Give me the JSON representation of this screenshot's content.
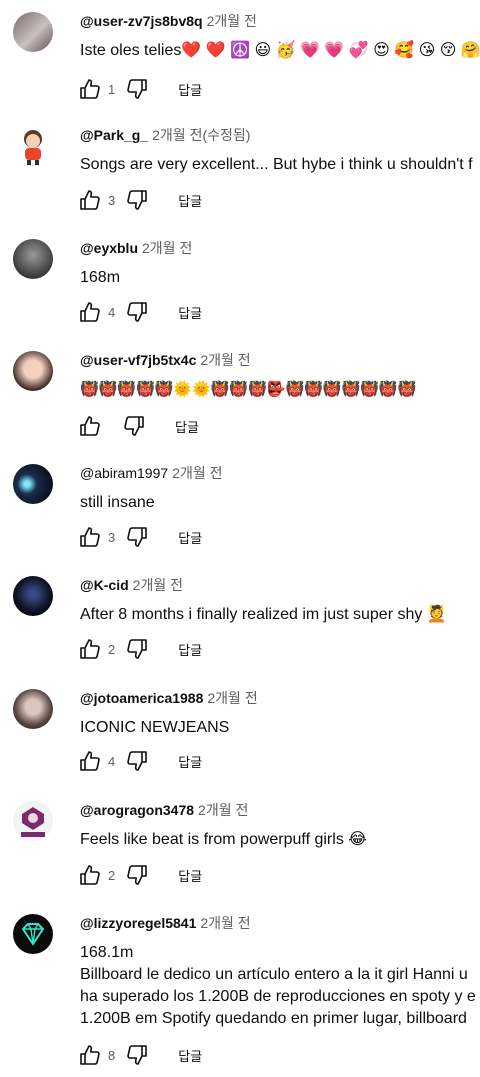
{
  "reply_label": "답글",
  "comments": [
    {
      "handle": "@user-zv7js8bv8q",
      "time": "2개월 전",
      "text": "Iste oles telies❤️ ❤️ ☮️ 😃 🥳 💗 💗 💞 😍 🥰 😘 😚 🤗",
      "likes": "1"
    },
    {
      "handle": "@Park_g_",
      "time": "2개월 전(수정됨)",
      "text": "Songs are very excellent... But hybe i think u shouldn't f",
      "likes": "3"
    },
    {
      "handle": "@eyxblu",
      "time": "2개월 전",
      "text": "168m",
      "likes": "4"
    },
    {
      "handle": "@user-vf7jb5tx4c",
      "time": "2개월 전",
      "text": "👹👹👹👹👹🌞🌞👹👹👹👺👹👹👹👹👹👹👹",
      "likes": ""
    },
    {
      "handle": "@abiram1997",
      "time": "2개월 전",
      "text": "still insane",
      "likes": "3"
    },
    {
      "handle": "@K-cid",
      "time": "2개월 전",
      "text": "After 8 months i finally realized im just super shy 💆",
      "likes": "2"
    },
    {
      "handle": "@jotoamerica1988",
      "time": "2개월 전",
      "text": "ICONIC NEWJEANS",
      "likes": "4"
    },
    {
      "handle": "@arogragon3478",
      "time": "2개월 전",
      "text": "Feels like beat is from powerpuff girls 😂",
      "likes": "2"
    },
    {
      "handle": "@lizzyoregel5841",
      "time": "2개월 전",
      "text": "168.1m",
      "extra": [
        "Billboard le dedico un artículo entero a la it girl Hanni u",
        "ha superado los 1.200B de reproducciones en spoty y e",
        "1.200B em Spotify quedando en primer lugar, billboard"
      ],
      "likes": "8"
    }
  ]
}
